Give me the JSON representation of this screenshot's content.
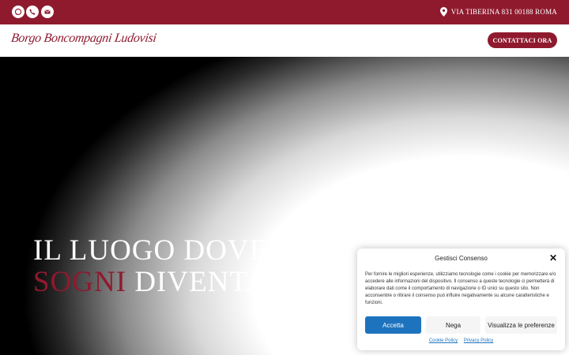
{
  "topbar": {
    "icons": [
      "whatsapp-icon",
      "phone-icon",
      "mail-icon"
    ],
    "address": "VIA TIBERINA 831 00188 ROMA"
  },
  "header": {
    "logo_text": "Borgo Boncompagni Ludovisi",
    "cta_label": "CONTATTACI ORA"
  },
  "hero": {
    "line1": "IL LUOGO DOVE I TUOI",
    "line2_accent": "SOGNI",
    "line2_rest": " DIVENTANO RE"
  },
  "consent": {
    "title": "Gestisci Consenso",
    "body": "Per fornire le migliori esperienze, utilizziamo tecnologie come i cookie per memorizzare e/o accedere alle informazioni del dispositivo. Il consenso a queste tecnologie ci permetterà di elaborare dati come il comportamento di navigazione o ID unici su questo sito. Non acconsentire o ritirare il consenso può influire negativamente su alcune caratteristiche e funzioni.",
    "accept": "Accetta",
    "deny": "Nega",
    "preferences": "Visualizza le preferenze",
    "cookie_policy": "Cookie Policy",
    "privacy_policy": "Privacy Policy"
  },
  "colors": {
    "brand": "#8f1a2e",
    "button_blue": "#1e73be"
  }
}
